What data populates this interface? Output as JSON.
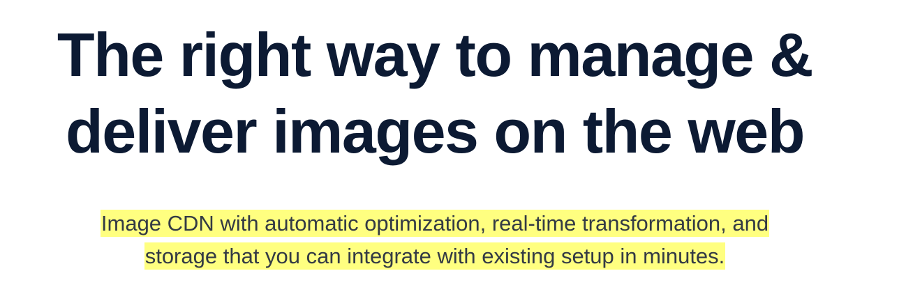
{
  "hero": {
    "headline_line1": "The right way to manage &",
    "headline_line2": "deliver images on the web",
    "subtitle_line1": "Image CDN with automatic optimization, real-time transformation, and",
    "subtitle_line2": "storage that you can integrate with existing setup in minutes."
  },
  "colors": {
    "headline": "#0c1a33",
    "subtitle": "#333a44",
    "highlight": "#ffff80",
    "background": "#ffffff"
  }
}
